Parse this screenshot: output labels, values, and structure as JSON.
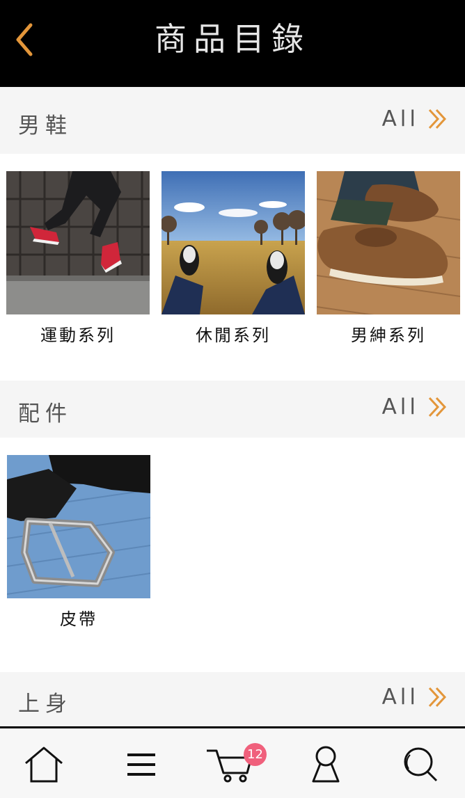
{
  "header": {
    "title": "商品目錄",
    "back_icon": "chevron-left-icon"
  },
  "colors": {
    "accent": "#e3963a",
    "header_bg": "#000000",
    "section_bg": "#f5f5f5",
    "badge": "#f0607c"
  },
  "sections": [
    {
      "title": "男鞋",
      "all_label": "All",
      "items": [
        {
          "label": "運動系列",
          "image": "jumping-sneakers-photo"
        },
        {
          "label": "休閒系列",
          "image": "sneakers-in-field-photo"
        },
        {
          "label": "男紳系列",
          "image": "boat-shoes-photo"
        }
      ]
    },
    {
      "title": "配件",
      "all_label": "All",
      "items": [
        {
          "label": "皮帶",
          "image": "leather-belt-photo"
        }
      ]
    },
    {
      "title": "上身",
      "all_label": "All",
      "items": []
    }
  ],
  "tabbar": {
    "items": [
      "home-icon",
      "menu-icon",
      "cart-icon",
      "user-icon",
      "search-icon"
    ],
    "cart_badge": "12"
  }
}
